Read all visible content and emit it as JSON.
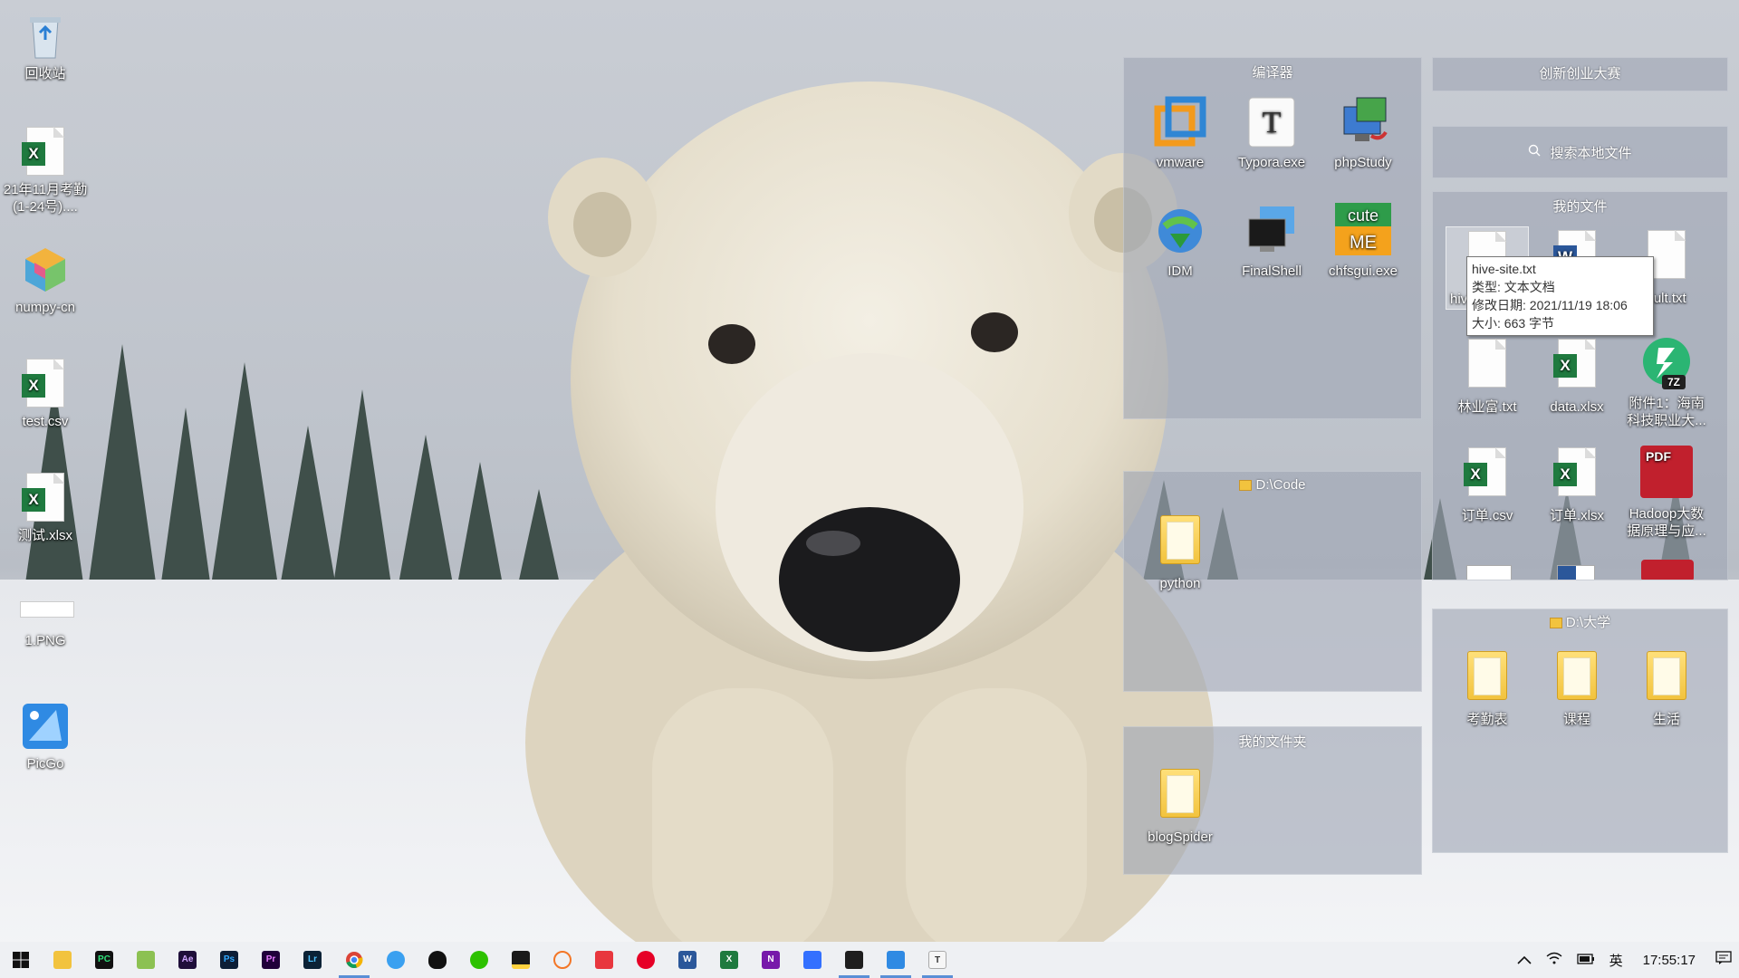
{
  "desktop_icons": [
    {
      "label": "回收站"
    },
    {
      "label": "21年11月考勤(1-24号)...."
    },
    {
      "label": "numpy-cn"
    },
    {
      "label": "test.csv"
    },
    {
      "label": "测试.xlsx"
    },
    {
      "label": "1.PNG"
    },
    {
      "label": "PicGo"
    }
  ],
  "fences": {
    "compiler": {
      "title": "编译器",
      "items": [
        {
          "label": "vmware"
        },
        {
          "label": "Typora.exe"
        },
        {
          "label": "phpStudy"
        },
        {
          "label": "IDM"
        },
        {
          "label": "FinalShell"
        },
        {
          "label": "chfsgui.exe"
        }
      ]
    },
    "contest": {
      "title": "创新创业大赛"
    },
    "search": {
      "placeholder": "搜索本地文件"
    },
    "myfiles": {
      "title": "我的文件",
      "items": [
        {
          "label": "hiv"
        },
        {
          "label": ""
        },
        {
          "label": "sult.txt"
        },
        {
          "label": "林业富.txt"
        },
        {
          "label": "data.xlsx"
        },
        {
          "label": "附件1：海南科技职业大..."
        },
        {
          "label": "订单.csv"
        },
        {
          "label": "订单.xlsx"
        },
        {
          "label": "Hadoop大数据原理与应..."
        }
      ]
    },
    "dcode": {
      "title": "D:\\Code",
      "items": [
        {
          "label": "python"
        }
      ]
    },
    "myfolder": {
      "title": "我的文件夹",
      "items": [
        {
          "label": "blogSpider"
        }
      ]
    },
    "university": {
      "title": "D:\\大学",
      "items": [
        {
          "label": "考勤表"
        },
        {
          "label": "课程"
        },
        {
          "label": "生活"
        }
      ]
    }
  },
  "tooltip": {
    "name": "hive-site.txt",
    "type": "类型: 文本文档",
    "modified": "修改日期: 2021/11/19 18:06",
    "size": "大小: 663 字节"
  },
  "taskbar": {
    "apps": [
      {
        "icon": "windows-start-icon"
      },
      {
        "icon": "file-explorer-icon"
      },
      {
        "icon": "pycharm-icon",
        "text": "PC"
      },
      {
        "icon": "notepad-plus-icon"
      },
      {
        "icon": "after-effects-icon",
        "text": "Ae"
      },
      {
        "icon": "photoshop-icon",
        "text": "Ps"
      },
      {
        "icon": "premiere-icon",
        "text": "Pr"
      },
      {
        "icon": "lightroom-icon",
        "text": "Lr"
      },
      {
        "icon": "chrome-icon"
      },
      {
        "icon": "baidu-netdisk-icon"
      },
      {
        "icon": "qq-icon"
      },
      {
        "icon": "wechat-icon"
      },
      {
        "icon": "sticky-notes-icon"
      },
      {
        "icon": "jupyter-icon"
      },
      {
        "icon": "xmind-icon"
      },
      {
        "icon": "netease-music-icon"
      },
      {
        "icon": "word-icon",
        "text": "W"
      },
      {
        "icon": "excel-icon",
        "text": "X"
      },
      {
        "icon": "onenote-icon",
        "text": "N"
      },
      {
        "icon": "feishu-icon"
      },
      {
        "icon": "terminal-icon"
      },
      {
        "icon": "picgo-icon"
      },
      {
        "icon": "typora-icon",
        "text": "T"
      }
    ],
    "ime": "英",
    "clock": "17:55:17"
  },
  "colors": {
    "fence_bg": "#a0a7b4",
    "taskbar_bg": "#eef0f3",
    "excel_green": "#1f7a3f",
    "word_blue": "#2b579a",
    "pdf_red": "#c1202d"
  }
}
